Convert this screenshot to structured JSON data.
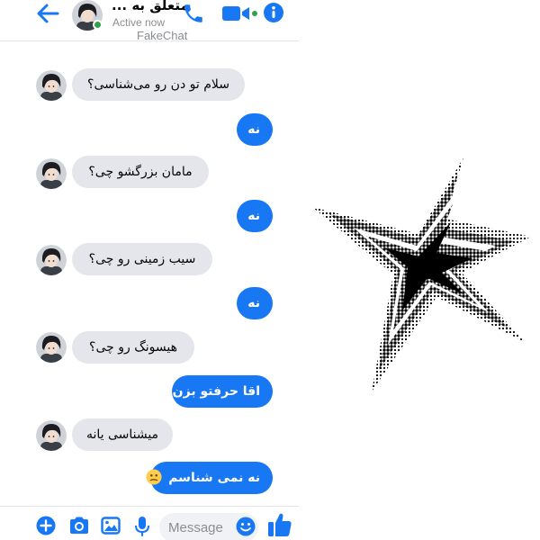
{
  "header": {
    "contact_name": "متعلق به ...",
    "status": "Active now",
    "watermark": "FakeChat",
    "icons": [
      "back-arrow-icon",
      "phone-icon",
      "video-camera-icon",
      "info-icon"
    ]
  },
  "messages": [
    {
      "side": "incoming",
      "text": "سلام تو دن رو می‌شناسی؟"
    },
    {
      "side": "outgoing",
      "text": "نه"
    },
    {
      "side": "incoming",
      "text": "مامان بزرگشو چی؟"
    },
    {
      "side": "outgoing",
      "text": "نه"
    },
    {
      "side": "incoming",
      "text": "سیب زمینی رو چی؟"
    },
    {
      "side": "outgoing",
      "text": "نه"
    },
    {
      "side": "incoming",
      "text": "هیسونگ رو چی؟"
    },
    {
      "side": "outgoing",
      "text": "اقا حرفتو بزن"
    },
    {
      "side": "incoming",
      "text": "میشناسی یانه"
    },
    {
      "side": "outgoing",
      "text": "نه نمی شناسم",
      "emoji": "confused-face-emoji"
    }
  ],
  "composer": {
    "placeholder": "Message",
    "icons": [
      "plus-icon",
      "camera-icon",
      "gallery-icon",
      "microphone-icon",
      "emoji-icon",
      "thumbs-up-icon"
    ]
  },
  "colors": {
    "accent": "#1877f2",
    "incoming_bubble": "#e4e6eb",
    "online": "#31a24c",
    "secondary_text": "#8a8d91",
    "star": "#000000"
  },
  "decoration": {
    "icon": "halftone-star-icon"
  }
}
